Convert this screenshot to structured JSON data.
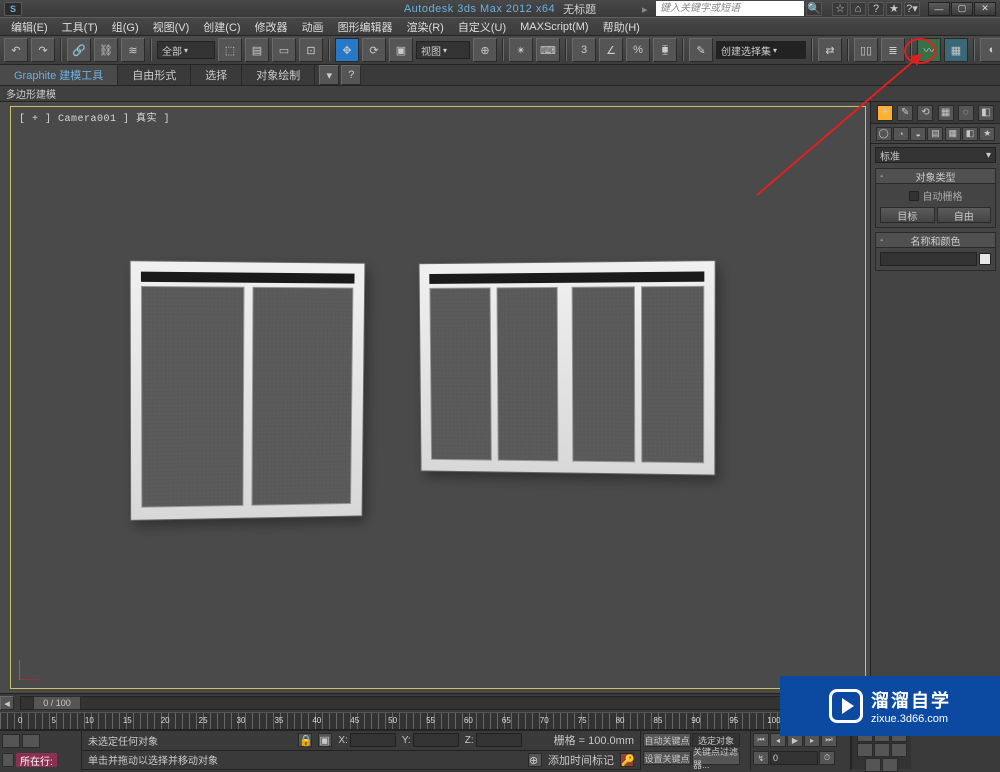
{
  "title": {
    "app": "Autodesk 3ds Max  2012  x64",
    "doc": "无标题",
    "logo": "S"
  },
  "search": {
    "placeholder": "键入关键字或短语"
  },
  "tb_icons": [
    "☆",
    "⌂",
    "?"
  ],
  "win_icons": [
    "—",
    "▢",
    "✕"
  ],
  "menu": [
    "编辑(E)",
    "工具(T)",
    "组(G)",
    "视图(V)",
    "创建(C)",
    "修改器",
    "动画",
    "图形编辑器",
    "渲染(R)",
    "自定义(U)",
    "MAXScript(M)",
    "帮助(H)"
  ],
  "toolbar": {
    "filter": "全部",
    "view_label": "视图",
    "selset": "创建选择集"
  },
  "ribbon": {
    "tabs": [
      "Graphite 建模工具",
      "自由形式",
      "选择",
      "对象绘制"
    ],
    "body": "多边形建模"
  },
  "viewport": {
    "label": "[ + ] Camera001 ] 真实 ]"
  },
  "cmd": {
    "tabs": [
      "☀",
      "✎",
      "⟲",
      "▦",
      "◌",
      "◧",
      "✦"
    ],
    "subs": [
      "◯",
      "◔",
      "◒",
      "▤",
      "▦",
      "◧",
      "★"
    ],
    "dropdown": "标准",
    "obj_type_head": "对象类型",
    "auto_grid": "自动栅格",
    "btn_target": "目标",
    "btn_free": "自由",
    "name_color_head": "名称和颜色"
  },
  "timeline": {
    "thumb": "0 / 100",
    "labels": [
      "0",
      "5",
      "10",
      "15",
      "20",
      "25",
      "30",
      "35",
      "40",
      "45",
      "50",
      "55",
      "60",
      "65",
      "70",
      "75",
      "80",
      "85",
      "90",
      "95",
      "100"
    ]
  },
  "status": {
    "current_label": "所在行:",
    "prompt1": "未选定任何对象",
    "prompt2": "单击并拖动以选择并移动对象",
    "grid": "栅格 = 100.0mm",
    "add_tag": "添加时间标记",
    "auto_key": "自动关键点",
    "sel_set": "选定对象",
    "set_key": "设置关键点",
    "key_filter": "关键点过滤器...",
    "frame": "0"
  },
  "watermark": {
    "cn": "溜溜自学",
    "url": "zixue.3d66.com"
  }
}
